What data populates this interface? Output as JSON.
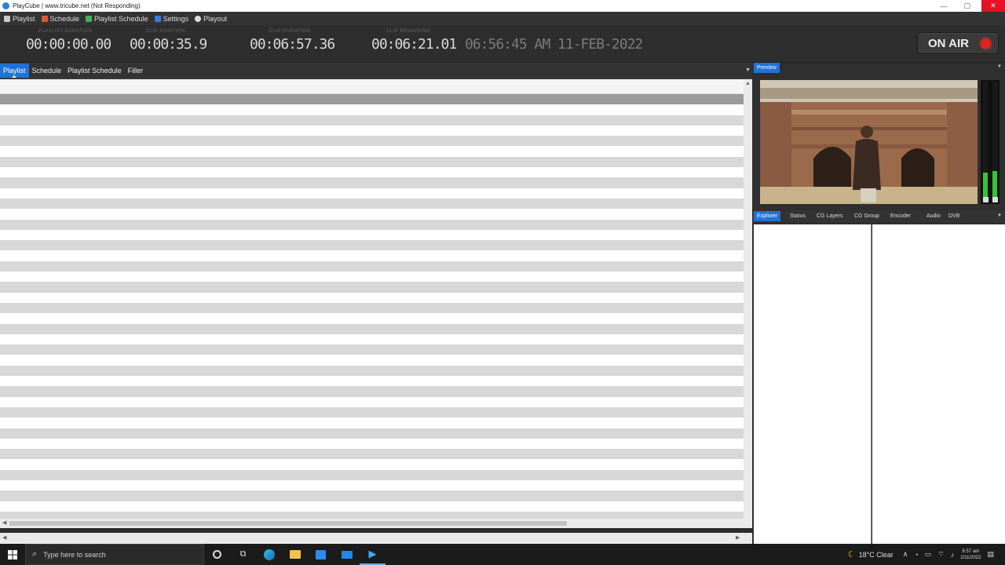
{
  "window": {
    "title": "PlayCube | www.tricube.net  (Not Responding)"
  },
  "menubar": {
    "items": [
      {
        "label": "Playlist",
        "icon": "playlist-icon",
        "color": "#c8c8c8"
      },
      {
        "label": "Schedule",
        "icon": "calendar-icon",
        "color": "#d35a3a"
      },
      {
        "label": "Playlist Schedule",
        "icon": "playlist-schedule-icon",
        "color": "#4caf50"
      },
      {
        "label": "Settings",
        "icon": "settings-icon",
        "color": "#3a7bd5"
      },
      {
        "label": "Playout",
        "icon": "playout-icon",
        "color": "#dddddd"
      }
    ]
  },
  "counters": {
    "playlist_duration": {
      "label": "PLAYLIST DURATION",
      "value": "00:00:00.00"
    },
    "clip_position": {
      "label": "CLIP POSITION",
      "value": "00:00:35.9"
    },
    "clip_duration": {
      "label": "CLIP DURATION",
      "value": "00:06:57.36"
    },
    "clip_remaining": {
      "label": "CLIP REMAINING",
      "value": "00:06:21.01"
    },
    "clock": "06:56:45 AM  11-FEB-2022"
  },
  "onair": {
    "label": "ON AIR",
    "indicator_color": "#e0231d"
  },
  "tabs": [
    {
      "label": "Playlist",
      "active": true
    },
    {
      "label": "Schedule",
      "active": false
    },
    {
      "label": "Playlist Schedule",
      "active": false
    },
    {
      "label": "Filler",
      "active": false
    }
  ],
  "preview": {
    "tab_label": "Preview"
  },
  "right_tabs": [
    {
      "label": "Explorer",
      "active": true
    },
    {
      "label": "Status",
      "active": false
    },
    {
      "label": "CG Layers",
      "active": false
    },
    {
      "label": "CG Group",
      "active": false
    },
    {
      "label": "Encoder",
      "active": false
    },
    {
      "label": "Audio",
      "active": false
    },
    {
      "label": "DVB",
      "active": false
    }
  ],
  "taskbar": {
    "search_placeholder": "Type here to search",
    "weather": "18°C  Clear",
    "time": "6:57 am",
    "date": "2/11/2022"
  },
  "colors": {
    "accent": "#1e73d6",
    "panel_dark": "#2e2e2e"
  }
}
